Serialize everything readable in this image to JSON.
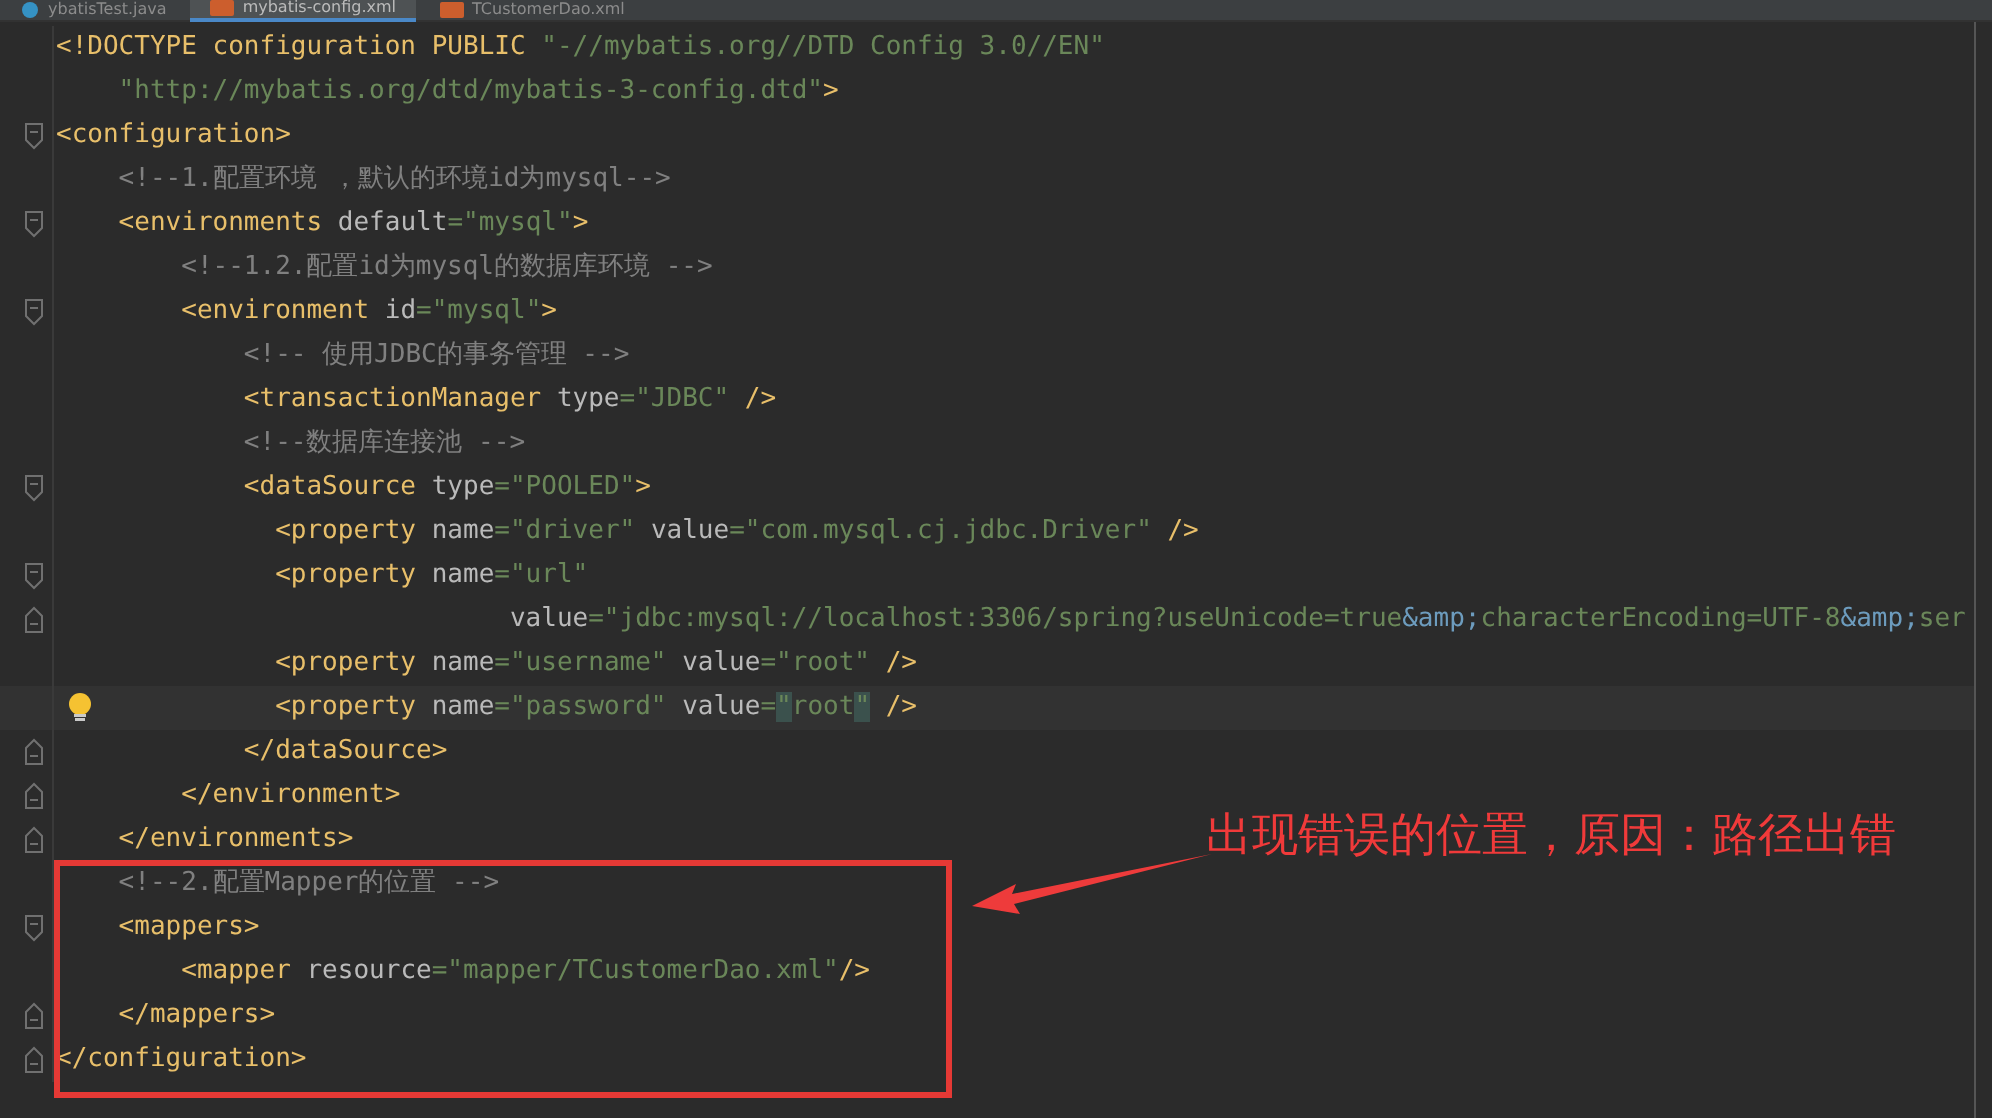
{
  "tabs": [
    {
      "label": "ybatisTest.java",
      "kind": "java",
      "selected": false
    },
    {
      "label": "mybatis-config.xml",
      "kind": "xml",
      "selected": true
    },
    {
      "label": "TCustomerDao.xml",
      "kind": "xml",
      "selected": false
    }
  ],
  "code_lines": [
    {
      "tokens": [
        {
          "kind": "tag",
          "text": "<!DOCTYPE configuration PUBLIC "
        },
        {
          "kind": "str",
          "text": "\"-//mybatis.org//DTD Config 3.0//EN\""
        }
      ]
    },
    {
      "tokens": [
        {
          "kind": "str",
          "text": "    \"http://mybatis.org/dtd/mybatis-3-config.dtd\""
        },
        {
          "kind": "tag",
          "text": ">"
        }
      ]
    },
    {
      "fold_start": true,
      "tokens": [
        {
          "kind": "tag",
          "text": "<configuration>"
        }
      ]
    },
    {
      "tokens": [
        {
          "kind": "comment",
          "text": "    <!--1.配置环境 ，默认的环境id为mysql-->"
        }
      ]
    },
    {
      "fold_start": true,
      "tokens": [
        {
          "kind": "tag",
          "text": "    <environments "
        },
        {
          "kind": "attr",
          "text": "default"
        },
        {
          "kind": "str",
          "text": "=\"mysql\""
        },
        {
          "kind": "tag",
          "text": ">"
        }
      ]
    },
    {
      "tokens": [
        {
          "kind": "comment",
          "text": "        <!--1.2.配置id为mysql的数据库环境 -->"
        }
      ]
    },
    {
      "fold_start": true,
      "tokens": [
        {
          "kind": "tag",
          "text": "        <environment "
        },
        {
          "kind": "attr",
          "text": "id"
        },
        {
          "kind": "str",
          "text": "=\"mysql\""
        },
        {
          "kind": "tag",
          "text": ">"
        }
      ]
    },
    {
      "tokens": [
        {
          "kind": "comment",
          "text": "            <!-- 使用JDBC的事务管理 -->"
        }
      ]
    },
    {
      "tokens": [
        {
          "kind": "tag",
          "text": "            <transactionManager "
        },
        {
          "kind": "attr",
          "text": "type"
        },
        {
          "kind": "str",
          "text": "=\"JDBC\" "
        },
        {
          "kind": "tag",
          "text": "/>"
        }
      ]
    },
    {
      "tokens": [
        {
          "kind": "comment",
          "text": "            <!--数据库连接池 -->"
        }
      ]
    },
    {
      "fold_start": true,
      "tokens": [
        {
          "kind": "tag",
          "text": "            <dataSource "
        },
        {
          "kind": "attr",
          "text": "type"
        },
        {
          "kind": "str",
          "text": "=\"POOLED\""
        },
        {
          "kind": "tag",
          "text": ">"
        }
      ]
    },
    {
      "tokens": [
        {
          "kind": "tag",
          "text": "              <property "
        },
        {
          "kind": "attr",
          "text": "name"
        },
        {
          "kind": "str",
          "text": "=\"driver\" "
        },
        {
          "kind": "attr",
          "text": "value"
        },
        {
          "kind": "str",
          "text": "=\"com.mysql.cj.jdbc.Driver\" "
        },
        {
          "kind": "tag",
          "text": "/>"
        }
      ]
    },
    {
      "fold_start": true,
      "tokens": [
        {
          "kind": "tag",
          "text": "              <property "
        },
        {
          "kind": "attr",
          "text": "name"
        },
        {
          "kind": "str",
          "text": "=\"url\""
        }
      ]
    },
    {
      "fold_end": true,
      "tokens": [
        {
          "kind": "attr",
          "text": "                             value"
        },
        {
          "kind": "str",
          "text": "=\"jdbc:mysql://localhost:3306/spring?useUnicode=true"
        },
        {
          "kind": "entity",
          "text": "&amp;"
        },
        {
          "kind": "str",
          "text": "characterEncoding=UTF-8"
        },
        {
          "kind": "entity",
          "text": "&amp;"
        },
        {
          "kind": "str",
          "text": "ser"
        }
      ]
    },
    {
      "tokens": [
        {
          "kind": "tag",
          "text": "              <property "
        },
        {
          "kind": "attr",
          "text": "name"
        },
        {
          "kind": "str",
          "text": "=\"username\" "
        },
        {
          "kind": "attr",
          "text": "value"
        },
        {
          "kind": "str",
          "text": "=\"root\" "
        },
        {
          "kind": "tag",
          "text": "/>"
        }
      ]
    },
    {
      "current": true,
      "hint": true,
      "tokens": [
        {
          "kind": "tag",
          "text": "              <property "
        },
        {
          "kind": "attr",
          "text": "name"
        },
        {
          "kind": "str",
          "text": "=\"password\" "
        },
        {
          "kind": "attr",
          "text": "value"
        },
        {
          "kind": "str",
          "text": "="
        },
        {
          "kind": "match",
          "text": "\""
        },
        {
          "kind": "str",
          "text": "root"
        },
        {
          "kind": "match",
          "text": "\""
        },
        {
          "kind": "tag",
          "text": " />"
        }
      ]
    },
    {
      "fold_end": true,
      "tokens": [
        {
          "kind": "tag",
          "text": "            </dataSource>"
        }
      ]
    },
    {
      "fold_end": true,
      "tokens": [
        {
          "kind": "tag",
          "text": "        </environment>"
        }
      ]
    },
    {
      "fold_end": true,
      "tokens": [
        {
          "kind": "tag",
          "text": "    </environments>"
        }
      ]
    },
    {
      "tokens": [
        {
          "kind": "comment",
          "text": "    <!--2.配置Mapper的位置 -->"
        }
      ]
    },
    {
      "fold_start": true,
      "tokens": [
        {
          "kind": "tag",
          "text": "    <mappers>"
        }
      ]
    },
    {
      "tokens": [
        {
          "kind": "tag",
          "text": "        <mapper "
        },
        {
          "kind": "attr",
          "text": "resource"
        },
        {
          "kind": "str",
          "text": "=\"mapper/TCustomerDao.xml\""
        },
        {
          "kind": "tag",
          "text": "/>"
        }
      ]
    },
    {
      "fold_end": true,
      "tokens": [
        {
          "kind": "tag",
          "text": "    </mappers>"
        }
      ]
    },
    {
      "fold_end": true,
      "tokens": [
        {
          "kind": "tag",
          "text": "</configuration>"
        }
      ]
    }
  ],
  "annotation": {
    "text": "出现错误的位置，原因：路径出错"
  }
}
